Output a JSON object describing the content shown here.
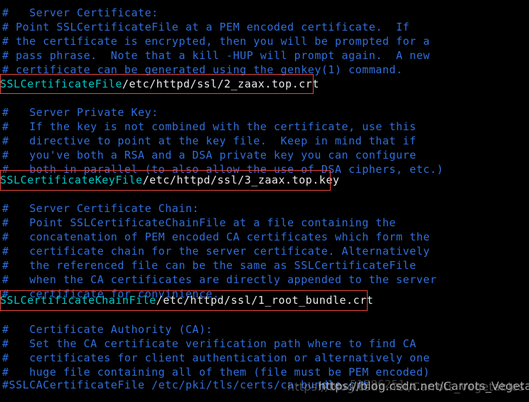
{
  "terminal": {
    "background_color": "#000000",
    "comment_color": "#2f6fdd",
    "directive_name_color": "#00c8c8",
    "directive_path_color": "#e8e8e8",
    "highlight_color": "#e8463c",
    "lines": [
      "#   Server Certificate:",
      "# Point SSLCertificateFile at a PEM encoded certificate.  If",
      "# the certificate is encrypted, then you will be prompted for a",
      "# pass phrase.  Note that a kill -HUP will prompt again.  A new",
      "# certificate can be generated using the genkey(1) command.",
      "",
      "#   Server Private Key:",
      "#   If the key is not combined with the certificate, use this",
      "#   directive to point at the key file.  Keep in mind that if",
      "#   you've both a RSA and a DSA private key you can configure",
      "#   both in parallel (to also allow the use of DSA ciphers, etc.)",
      "",
      "#   Server Certificate Chain:",
      "#   Point SSLCertificateChainFile at a file containing the",
      "#   concatenation of PEM encoded CA certificates which form the",
      "#   certificate chain for the server certificate. Alternatively",
      "#   the referenced file can be the same as SSLCertificateFile",
      "#   when the CA certificates are directly appended to the server",
      "#   certificate for convinience.",
      "",
      "#   Certificate Authority (CA):",
      "#   Set the CA certificate verification path where to find CA",
      "#   certificates for client authentication or alternatively one",
      "#   huge file containing all of them (file must be PEM encoded)",
      "#SSLCACertificateFile /etc/pki/tls/certs/ca-bundle.crt"
    ],
    "directives": [
      {
        "name": "SSLCertificateFile",
        "path": "/etc/httpd/ssl/2_zaax.top.crt"
      },
      {
        "name": "SSLCertificateKeyFile",
        "path": "/etc/httpd/ssl/3_zaax.top.key"
      },
      {
        "name": "SSLCertificateChainFile",
        "path": "/etc/httpd/ssl/1_root_bundle.crt"
      }
    ],
    "watermark": {
      "part_a": "https://blog.csdn.net/Carrots_Vegetables",
      "part_b": "https://blog.csdn.net/Carrots_Vegetables",
      "part_c": "51786251"
    }
  }
}
